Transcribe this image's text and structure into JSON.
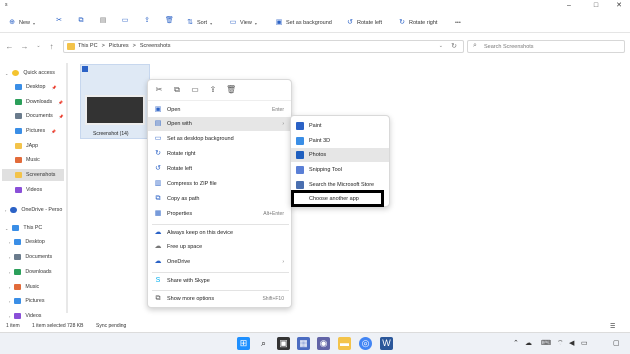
{
  "window": {
    "title": "s",
    "controls": {
      "minimize": "–",
      "maximize": "□",
      "close": "✕"
    }
  },
  "toolbar": {
    "new_label": "New",
    "sort_label": "Sort",
    "view_label": "View",
    "set_background_label": "Set as background",
    "rotate_left_label": "Rotate left",
    "rotate_right_label": "Rotate right",
    "more_label": "•••"
  },
  "address": {
    "crumbs": [
      "This PC",
      ">",
      "Pictures",
      ">",
      "Screenshots"
    ],
    "search_placeholder": "Search Screenshots"
  },
  "sidebar": {
    "items": [
      {
        "label": "Quick access",
        "icon": "star-icon",
        "color": "#f4c430"
      },
      {
        "label": "Desktop",
        "icon": "desktop-icon",
        "color": "#3a8ee6"
      },
      {
        "label": "Downloads",
        "icon": "download-icon",
        "color": "#2b9f5a"
      },
      {
        "label": "Documents",
        "icon": "documents-icon",
        "color": "#6a7b8c"
      },
      {
        "label": "Pictures",
        "icon": "pictures-icon",
        "color": "#3a8ee6"
      },
      {
        "label": "JApp",
        "icon": "folder-icon",
        "color": "#f3c34a"
      },
      {
        "label": "Music",
        "icon": "music-icon",
        "color": "#e26b3a"
      },
      {
        "label": "Screenshots",
        "icon": "folder-icon",
        "color": "#f3c34a"
      },
      {
        "label": "Videos",
        "icon": "videos-icon",
        "color": "#8a4fd8"
      },
      {
        "label": "OneDrive - Perso",
        "icon": "cloud-icon",
        "color": "#2b62c6"
      },
      {
        "label": "This PC",
        "icon": "pc-icon",
        "color": "#3a8ee6"
      },
      {
        "label": "Desktop",
        "icon": "desktop-icon",
        "color": "#3a8ee6"
      },
      {
        "label": "Documents",
        "icon": "documents-icon",
        "color": "#6a7b8c"
      },
      {
        "label": "Downloads",
        "icon": "download-icon",
        "color": "#2b9f5a"
      },
      {
        "label": "Music",
        "icon": "music-icon",
        "color": "#e26b3a"
      },
      {
        "label": "Pictures",
        "icon": "pictures-icon",
        "color": "#3a8ee6"
      },
      {
        "label": "Videos",
        "icon": "videos-icon",
        "color": "#8a4fd8"
      }
    ]
  },
  "file": {
    "name": "Screenshot (14)"
  },
  "context_menu": {
    "items": [
      {
        "label": "Open",
        "shortcut": "Enter",
        "icon": "open-icon"
      },
      {
        "label": "Open with",
        "shortcut": "›",
        "icon": "open-with-icon"
      },
      {
        "label": "Set as desktop background",
        "shortcut": "",
        "icon": "background-icon"
      },
      {
        "label": "Rotate right",
        "shortcut": "",
        "icon": "rotate-right-icon"
      },
      {
        "label": "Rotate left",
        "shortcut": "",
        "icon": "rotate-left-icon"
      },
      {
        "label": "Compress to ZIP file",
        "shortcut": "",
        "icon": "zip-icon"
      },
      {
        "label": "Copy as path",
        "shortcut": "",
        "icon": "copy-path-icon"
      },
      {
        "label": "Properties",
        "shortcut": "Alt+Enter",
        "icon": "properties-icon"
      },
      {
        "label": "Always keep on this device",
        "shortcut": "",
        "icon": "keep-icon"
      },
      {
        "label": "Free up space",
        "shortcut": "",
        "icon": "cloud-icon"
      },
      {
        "label": "OneDrive",
        "shortcut": "›",
        "icon": "onedrive-icon"
      },
      {
        "label": "Share with Skype",
        "shortcut": "",
        "icon": "skype-icon"
      },
      {
        "label": "Show more options",
        "shortcut": "Shift+F10",
        "icon": "more-options-icon"
      }
    ]
  },
  "submenu": {
    "items": [
      {
        "label": "Paint",
        "color": "#2b62c6"
      },
      {
        "label": "Paint 3D",
        "color": "#3a8ee6"
      },
      {
        "label": "Photos",
        "color": "#1f5fbf"
      },
      {
        "label": "Snipping Tool",
        "color": "#5a7fd6"
      },
      {
        "label": "Search the Microsoft Store",
        "color": "#4a6fb0"
      }
    ],
    "choose_label": "Choose another app"
  },
  "status": {
    "count": "1 item",
    "selected": "1 item selected  728 KB",
    "sync": "Sync pending"
  }
}
